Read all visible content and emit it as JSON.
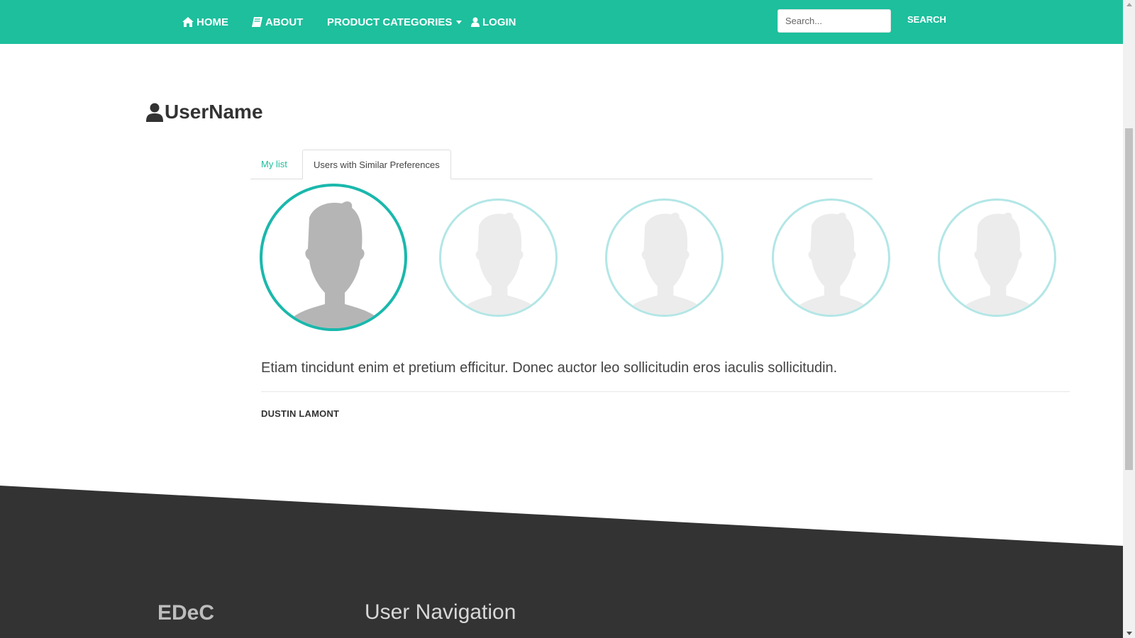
{
  "nav": {
    "items": [
      {
        "label": "HOME",
        "icon": "home-icon"
      },
      {
        "label": "ABOUT",
        "icon": "book-icon"
      },
      {
        "label": "PRODUCT CATEGORIES",
        "icon": "chevron-down-icon"
      },
      {
        "label": "LOGIN",
        "icon": "user-icon"
      }
    ],
    "search_placeholder": "Search...",
    "search_label": "SEARCH",
    "bg_color": "#1dbf9d"
  },
  "profile": {
    "title": "UserName",
    "icon": "user-icon"
  },
  "tabs": [
    {
      "label": "My list",
      "active": false
    },
    {
      "label": "Users with Similar Preferences",
      "active": true
    }
  ],
  "testimonials": {
    "avatars_count": 5,
    "active_index": 0,
    "quote": "Etiam tincidunt enim et pretium efficitur. Donec auctor leo sollicitudin eros iaculis sollicitudin.",
    "author": "DUSTIN LAMONT",
    "accent_color": "#1ab8ac"
  },
  "footer": {
    "brand": "EDeC",
    "heading": "User Navigation",
    "bg_color": "#333333"
  }
}
